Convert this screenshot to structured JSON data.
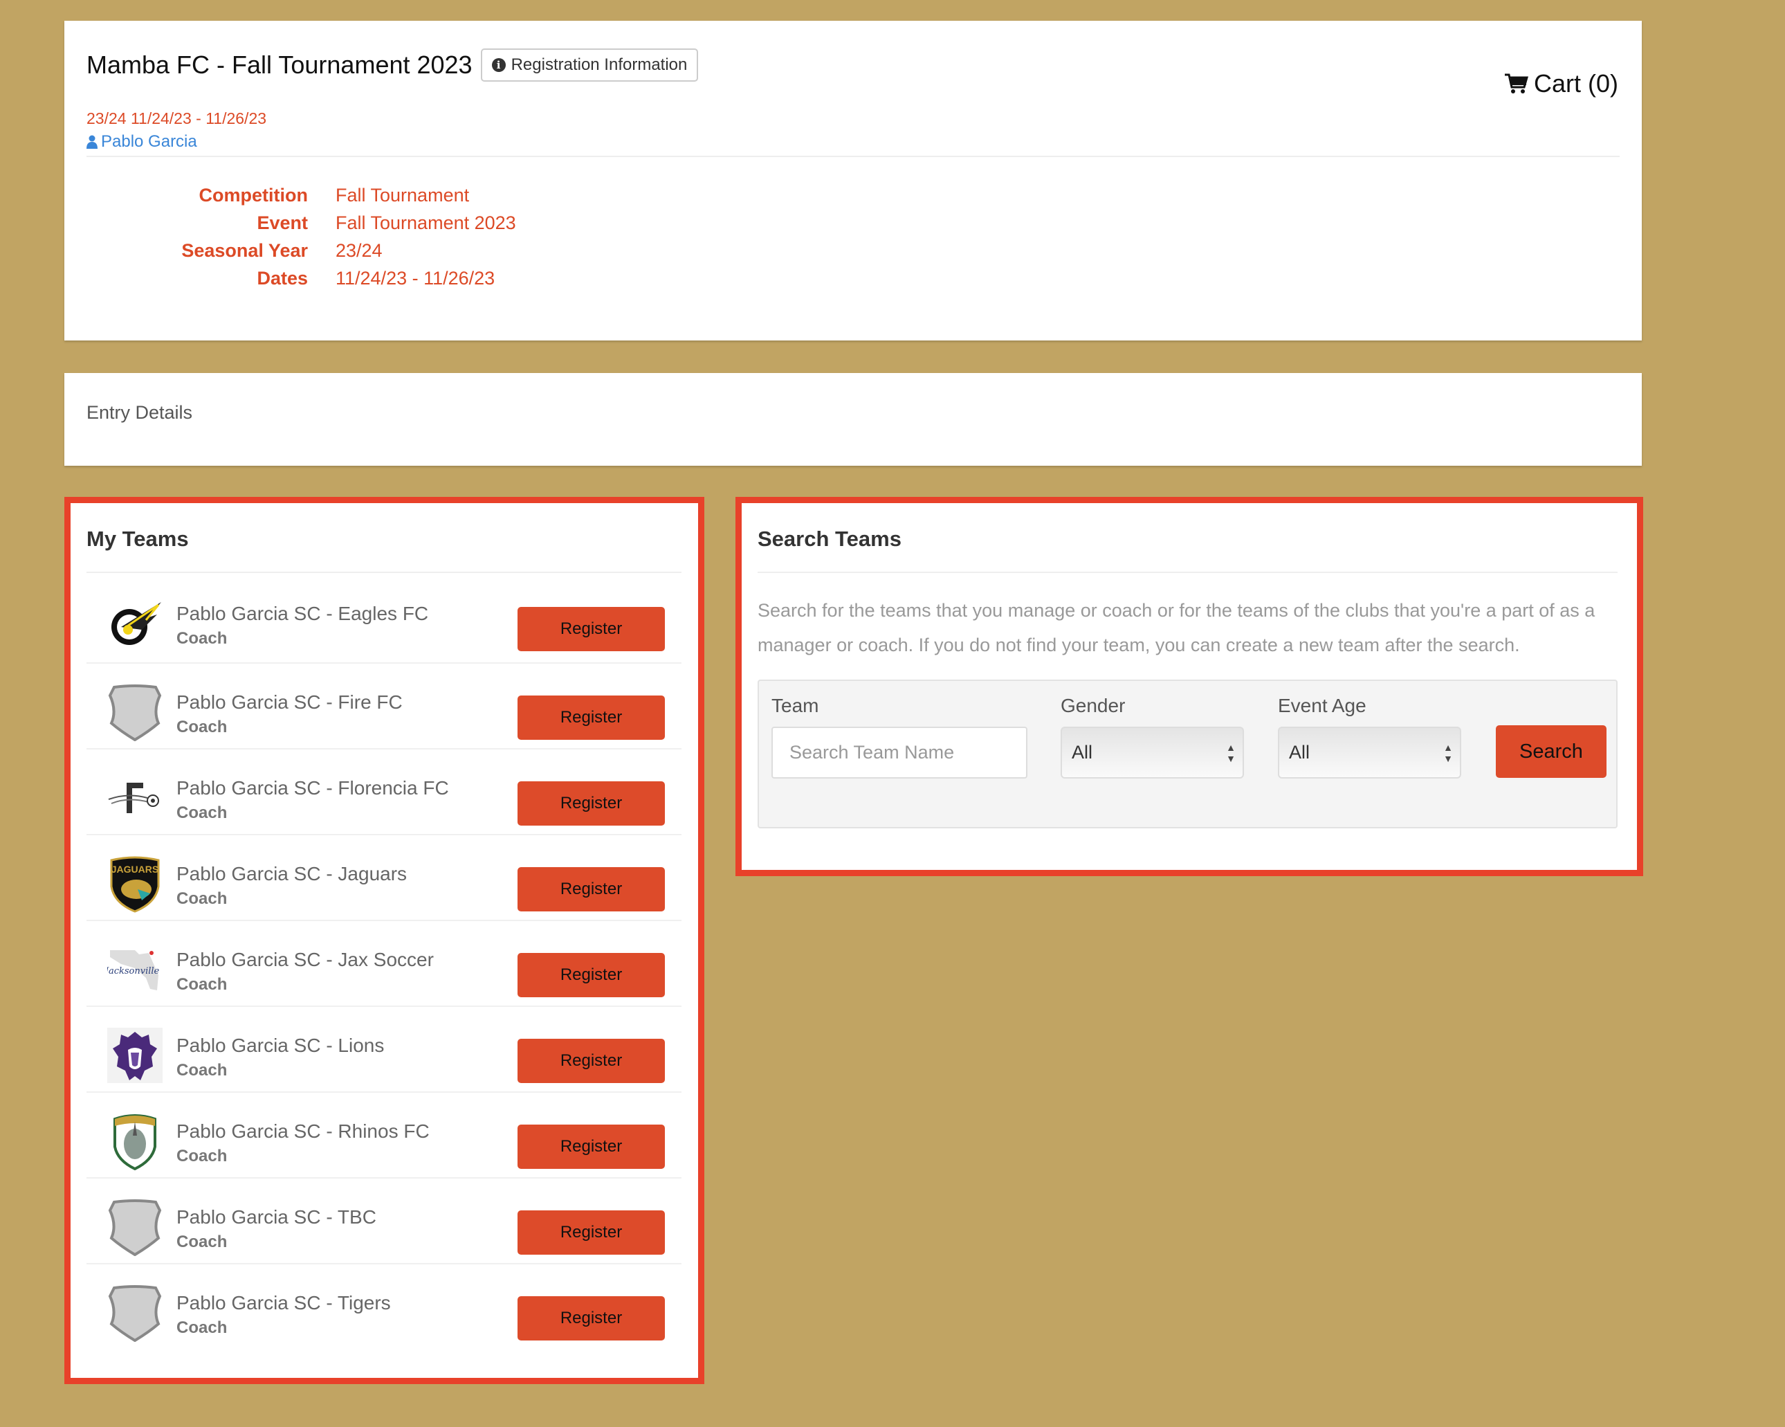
{
  "header": {
    "title": "Mamba FC - Fall Tournament 2023",
    "registration_info_label": "Registration Information",
    "subtitle_dates": "23/24 11/24/23 - 11/26/23",
    "user_name": "Pablo Garcia",
    "cart_label": "Cart (0)",
    "details": [
      {
        "label": "Competition",
        "value": "Fall Tournament"
      },
      {
        "label": "Event",
        "value": "Fall Tournament 2023"
      },
      {
        "label": "Seasonal Year",
        "value": "23/24"
      },
      {
        "label": "Dates",
        "value": "11/24/23 - 11/26/23"
      }
    ]
  },
  "entry_details": {
    "title": "Entry Details"
  },
  "my_teams": {
    "title": "My Teams",
    "register_label": "Register",
    "teams": [
      {
        "name": "Pablo Garcia SC - Eagles FC",
        "role": "Coach",
        "logo": "eagle-logo"
      },
      {
        "name": "Pablo Garcia SC - Fire FC",
        "role": "Coach",
        "logo": "shield-placeholder"
      },
      {
        "name": "Pablo Garcia SC - Florencia FC",
        "role": "Coach",
        "logo": "florencia-logo"
      },
      {
        "name": "Pablo Garcia SC - Jaguars",
        "role": "Coach",
        "logo": "jaguar-logo"
      },
      {
        "name": "Pablo Garcia SC - Jax Soccer",
        "role": "Coach",
        "logo": "jacksonville-logo"
      },
      {
        "name": "Pablo Garcia SC - Lions",
        "role": "Coach",
        "logo": "lion-logo"
      },
      {
        "name": "Pablo Garcia SC - Rhinos FC",
        "role": "Coach",
        "logo": "rhino-logo"
      },
      {
        "name": "Pablo Garcia SC - TBC",
        "role": "Coach",
        "logo": "shield-placeholder"
      },
      {
        "name": "Pablo Garcia SC - Tigers",
        "role": "Coach",
        "logo": "shield-placeholder"
      }
    ]
  },
  "search_teams": {
    "title": "Search Teams",
    "description": "Search for the teams that you manage or coach or for the teams of the clubs that you're a part of as a manager or coach. If you do not find your team, you can create a new team after the search.",
    "team_label": "Team",
    "team_placeholder": "Search Team Name",
    "team_value": "",
    "gender_label": "Gender",
    "gender_value": "All",
    "event_age_label": "Event Age",
    "event_age_value": "All",
    "search_label": "Search"
  },
  "colors": {
    "background": "#c1a463",
    "accent": "#dd4b2a",
    "highlight_border": "#e8412a",
    "link": "#3a86d8"
  }
}
